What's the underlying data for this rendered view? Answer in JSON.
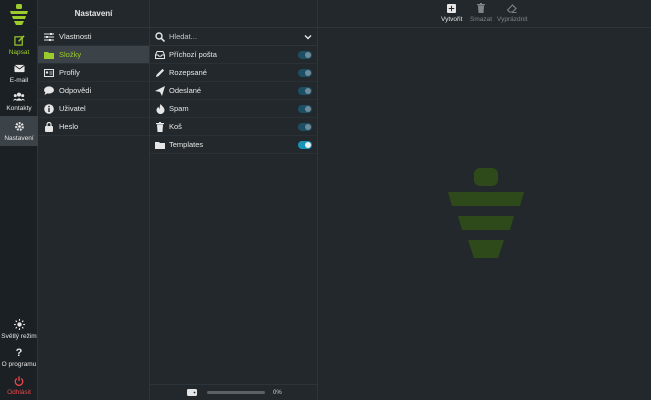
{
  "rail": {
    "items": [
      {
        "label": "Napsat",
        "icon": "compose-icon"
      },
      {
        "label": "E-mail",
        "icon": "envelope-icon"
      },
      {
        "label": "Kontakty",
        "icon": "contacts-icon"
      },
      {
        "label": "Nastavení",
        "icon": "gear-icon"
      }
    ],
    "bottom": [
      {
        "label": "Světlý režim",
        "icon": "sun-icon"
      },
      {
        "label": "O programu",
        "icon": "question-icon"
      },
      {
        "label": "Odhlásit",
        "icon": "power-icon"
      }
    ]
  },
  "menu": {
    "title": "Nastavení",
    "items": [
      {
        "label": "Vlastnosti",
        "icon": "sliders-icon"
      },
      {
        "label": "Složky",
        "icon": "folder-icon"
      },
      {
        "label": "Profily",
        "icon": "id-card-icon"
      },
      {
        "label": "Odpovědi",
        "icon": "comment-icon"
      },
      {
        "label": "Uživatel",
        "icon": "info-icon"
      },
      {
        "label": "Heslo",
        "icon": "lock-icon"
      }
    ]
  },
  "folders": {
    "search_placeholder": "Hledat...",
    "items": [
      {
        "label": "Příchozí pošta",
        "icon": "inbox-icon",
        "subscribed": false
      },
      {
        "label": "Rozepsané",
        "icon": "pencil-icon",
        "subscribed": false
      },
      {
        "label": "Odeslané",
        "icon": "paper-plane-icon",
        "subscribed": false
      },
      {
        "label": "Spam",
        "icon": "fire-icon",
        "subscribed": false
      },
      {
        "label": "Koš",
        "icon": "trash-icon",
        "subscribed": false
      },
      {
        "label": "Templates",
        "icon": "folder-icon",
        "subscribed": true
      }
    ],
    "quota_percent": "0%"
  },
  "toolbar": {
    "create": "Vytvořit",
    "delete": "Smazat",
    "empty": "Vyprázdnit"
  },
  "colors": {
    "accent": "#9ccc2c",
    "logo_dark": "#2f4a1a",
    "danger": "#e8464b",
    "toggle_on": "#1a93b8"
  }
}
